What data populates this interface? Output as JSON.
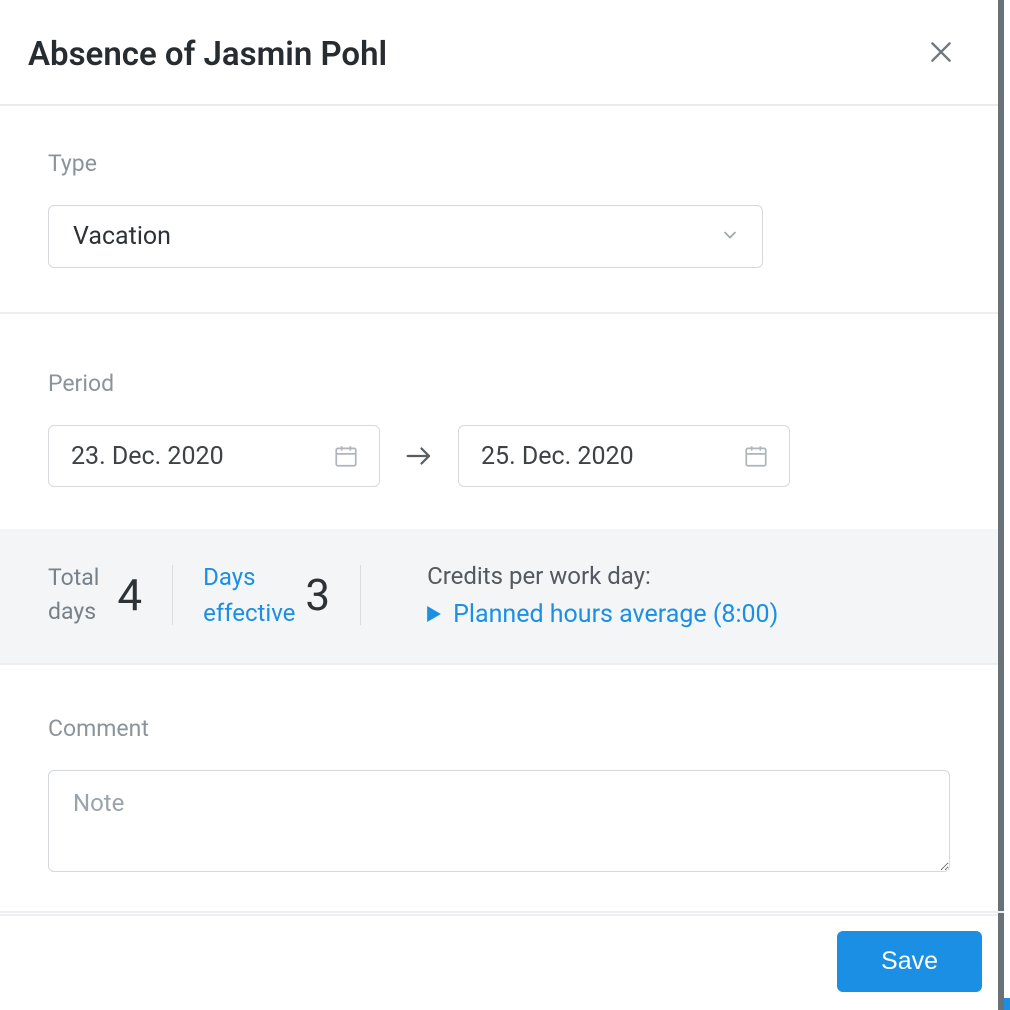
{
  "header": {
    "title": "Absence of Jasmin Pohl"
  },
  "type": {
    "label": "Type",
    "selected": "Vacation"
  },
  "period": {
    "label": "Period",
    "start_date": "23. Dec. 2020",
    "end_date": "25. Dec. 2020"
  },
  "stats": {
    "total_days_label": "Total\ndays",
    "total_days_value": "4",
    "days_effective_label": "Days\neffective",
    "days_effective_value": "3",
    "credits_label": "Credits per work day:",
    "credits_link": "Planned hours average (8:00)"
  },
  "comment": {
    "label": "Comment",
    "placeholder": "Note"
  },
  "footer": {
    "save_label": "Save"
  }
}
